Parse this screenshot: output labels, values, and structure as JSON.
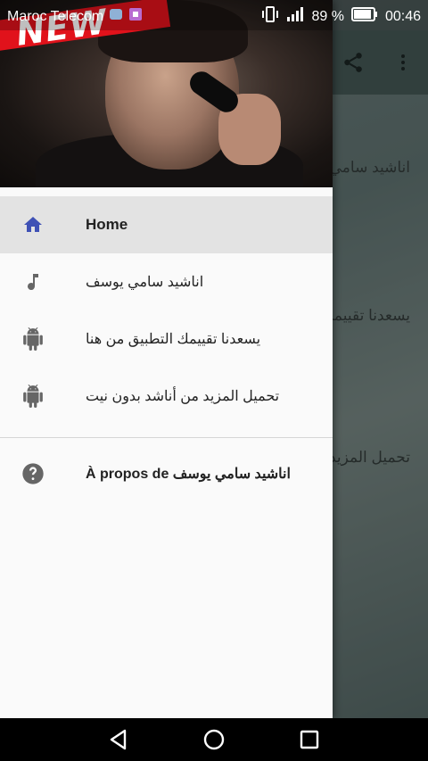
{
  "status_bar": {
    "carrier": "Maroc Telecom",
    "battery_percent": "89 %",
    "time": "00:46"
  },
  "background_app": {
    "rows": [
      "اناشيد سامي يوسف",
      "يسعدنا تقييمك التطبيق من هنا",
      "تحميل المزيد من أناشد بدون نيت"
    ]
  },
  "drawer": {
    "header_badge": "NEW",
    "items": [
      {
        "label": "Home",
        "icon": "home-icon",
        "active": true
      },
      {
        "label": "اناشيد سامي يوسف",
        "icon": "music-note-icon"
      },
      {
        "label": "يسعدنا تقييمك التطبيق من هنا",
        "icon": "android-icon"
      },
      {
        "label": "تحميل المزيد من أناشد بدون نيت",
        "icon": "android-icon"
      }
    ],
    "about": {
      "label": "À propos de اناشيد سامي يوسف",
      "icon": "help-icon"
    }
  },
  "colors": {
    "active_icon": "#3f51b5",
    "icon_gray": "#666666",
    "badge_red": "#e1121b"
  }
}
